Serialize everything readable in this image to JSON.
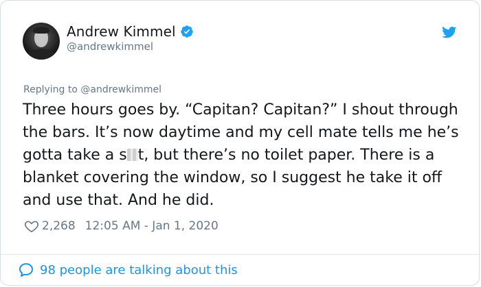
{
  "author": {
    "display_name": "Andrew Kimmel",
    "handle": "@andrewkimmel",
    "verified": true
  },
  "reply": {
    "prefix": "Replying to ",
    "to_handle": "@andrewkimmel"
  },
  "tweet": {
    "text_before_censor": "Three hours goes by. “Capitan? Capitan?” I shout through the bars. It’s now daytime and my cell mate tells me he’s gotta take a s",
    "text_after_censor": "t, but there’s no toilet paper. There is a blanket covering the window, so I suggest he take it off and use that. And he did."
  },
  "meta": {
    "like_count": "2,268",
    "timestamp": "12:05 AM - Jan 1, 2020"
  },
  "footer": {
    "talking_text": "98 people are talking about this"
  },
  "icons": {
    "verified": "verified-badge-icon",
    "brand": "twitter-bird-icon",
    "like": "heart-icon",
    "conversation": "speech-bubble-icon"
  },
  "colors": {
    "twitter_blue": "#1da1f2",
    "link_blue": "#1b95e0",
    "secondary_text": "#657786",
    "primary_text": "#14171a"
  }
}
